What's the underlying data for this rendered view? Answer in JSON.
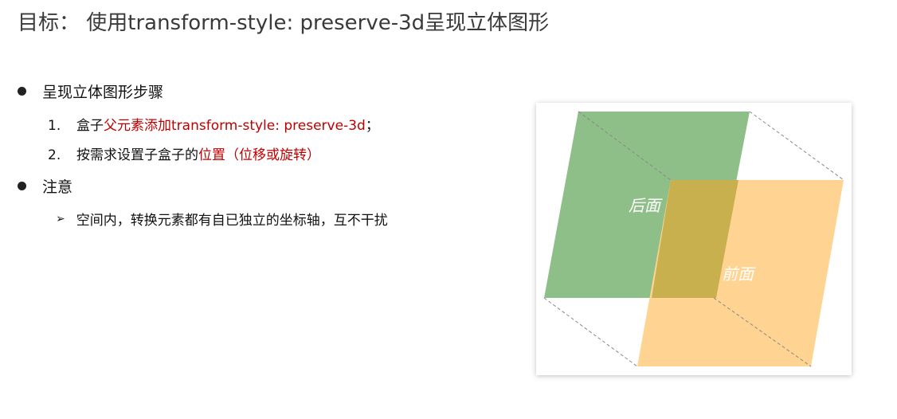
{
  "title": "目标： 使用transform-style: preserve-3d呈现立体图形",
  "section1": {
    "heading": "呈现立体图形步骤",
    "steps": [
      {
        "num": "1.",
        "pre": "盒子",
        "highlight": "父元素添加transform-style: preserve-3d",
        "post": "；"
      },
      {
        "num": "2.",
        "pre": "按需求设置子盒子的",
        "highlight": "位置（位移或旋转）",
        "post": ""
      }
    ]
  },
  "section2": {
    "heading": "注意",
    "note": "空间内，转换元素都有自已独立的坐标轴，互不干扰"
  },
  "diagram": {
    "back_label": "后面",
    "front_label": "前面",
    "colors": {
      "back_face": "#8fbf88",
      "front_face": "#ffd391",
      "overlap": "#c9b04e",
      "dashed_edge": "#888888",
      "highlight_text": "#c00000"
    }
  }
}
